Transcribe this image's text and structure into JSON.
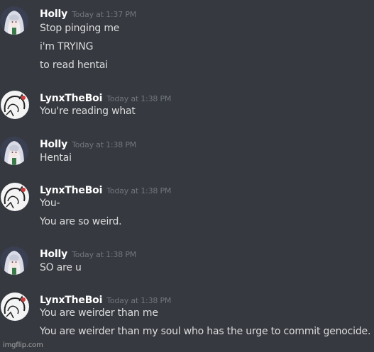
{
  "colors": {
    "background": "#36393f",
    "username": "#ffffff",
    "timestamp": "#72767d",
    "message_text": "#dcddde"
  },
  "messages": [
    {
      "author": "Holly",
      "avatar_icon": "anime-girl-avatar-icon",
      "timestamp": "Today at 1:37 PM",
      "lines": [
        "Stop pinging me",
        "i'm TRYING",
        "to read hentai"
      ]
    },
    {
      "author": "LynxTheBoi",
      "avatar_icon": "sketch-character-avatar-icon",
      "timestamp": "Today at 1:38 PM",
      "lines": [
        "You're reading what"
      ]
    },
    {
      "author": "Holly",
      "avatar_icon": "anime-girl-avatar-icon",
      "timestamp": "Today at 1:38 PM",
      "lines": [
        "Hentai"
      ]
    },
    {
      "author": "LynxTheBoi",
      "avatar_icon": "sketch-character-avatar-icon",
      "timestamp": "Today at 1:38 PM",
      "lines": [
        "You-",
        "You are so weird."
      ]
    },
    {
      "author": "Holly",
      "avatar_icon": "anime-girl-avatar-icon",
      "timestamp": "Today at 1:38 PM",
      "lines": [
        "SO are u"
      ]
    },
    {
      "author": "LynxTheBoi",
      "avatar_icon": "sketch-character-avatar-icon",
      "timestamp": "Today at 1:38 PM",
      "lines": [
        "You are weirder than me",
        "You are weirder than my soul who has the urge to commit genocide."
      ]
    }
  ],
  "watermark": "imgflip.com"
}
